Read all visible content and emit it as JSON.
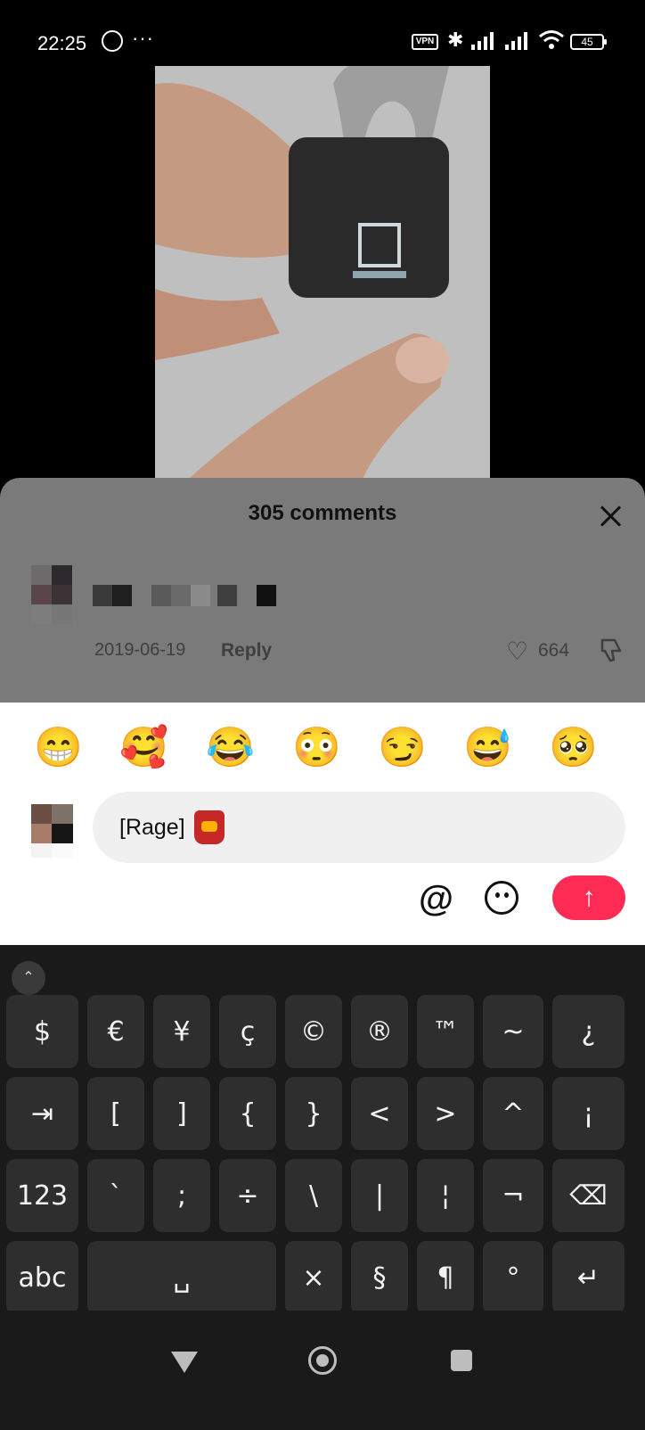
{
  "status_bar": {
    "time": "22:25",
    "dots": "···",
    "vpn": "VPN",
    "battery": "45",
    "bluetooth": "✱"
  },
  "colors": {
    "accent": "#fe2c55",
    "keyboard_bg": "#1a1a1a",
    "key_bg": "#2e2e2e",
    "overlay": "#7a7a7a"
  },
  "comments": {
    "title": "305 comments",
    "item": {
      "date": "2019-06-19",
      "reply": "Reply",
      "likes": "664"
    }
  },
  "emoji_bar": [
    "😁",
    "🥰",
    "😂",
    "😳",
    "😏",
    "😅",
    "🥺"
  ],
  "composer": {
    "text": "[Rage]",
    "at": "@",
    "send": "↑"
  },
  "keyboard": {
    "collapse": "⌃",
    "rows": [
      [
        "$",
        "€",
        "¥",
        "ç",
        "©",
        "®",
        "™",
        "~",
        "¿"
      ],
      [
        "⇥",
        "[",
        "]",
        "{",
        "}",
        "<",
        ">",
        "^",
        "¡"
      ],
      [
        "123",
        "`",
        ";",
        "÷",
        "\\",
        "|",
        "¦",
        "¬",
        "⌫"
      ],
      [
        "abc",
        "␣",
        "×",
        "§",
        "¶",
        "°",
        "↵"
      ]
    ]
  }
}
